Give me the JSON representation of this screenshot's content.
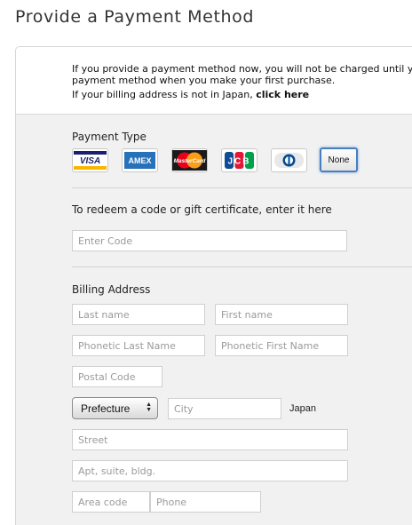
{
  "header": {
    "title": "Provide a Payment Method"
  },
  "notice": {
    "line1": "If you provide a payment method now, you will not be charged until you",
    "line2": "payment method when you make your first purchase.",
    "line3_prefix": "If your billing address is not in Japan, ",
    "line3_link": "click here"
  },
  "payment": {
    "label": "Payment Type",
    "cards": [
      {
        "name": "visa",
        "text": "VISA",
        "color": "#1a1f71"
      },
      {
        "name": "amex",
        "text": "AMEX",
        "color": "#2671b9"
      },
      {
        "name": "mastercard",
        "text": "MasterCard",
        "color": "#eb001b"
      },
      {
        "name": "jcb",
        "text": "JCB",
        "color": "#0e4c96"
      },
      {
        "name": "diners",
        "text": "",
        "color": "#004a97"
      }
    ],
    "none_label": "None"
  },
  "redeem": {
    "label": "To redeem a code or gift certificate, enter it here",
    "placeholder": "Enter Code"
  },
  "billing": {
    "label": "Billing Address",
    "last_name": "Last name",
    "first_name": "First name",
    "phonetic_last": "Phonetic Last Name",
    "phonetic_first": "Phonetic First Name",
    "postal": "Postal Code",
    "prefecture": "Prefecture",
    "city": "City",
    "country": "Japan",
    "street": "Street",
    "apt": "Apt, suite, bldg.",
    "area_code": "Area code",
    "phone": "Phone"
  },
  "colors": {
    "selected_border": "#4a7fbf",
    "panel_bg": "#f1f1f1"
  }
}
